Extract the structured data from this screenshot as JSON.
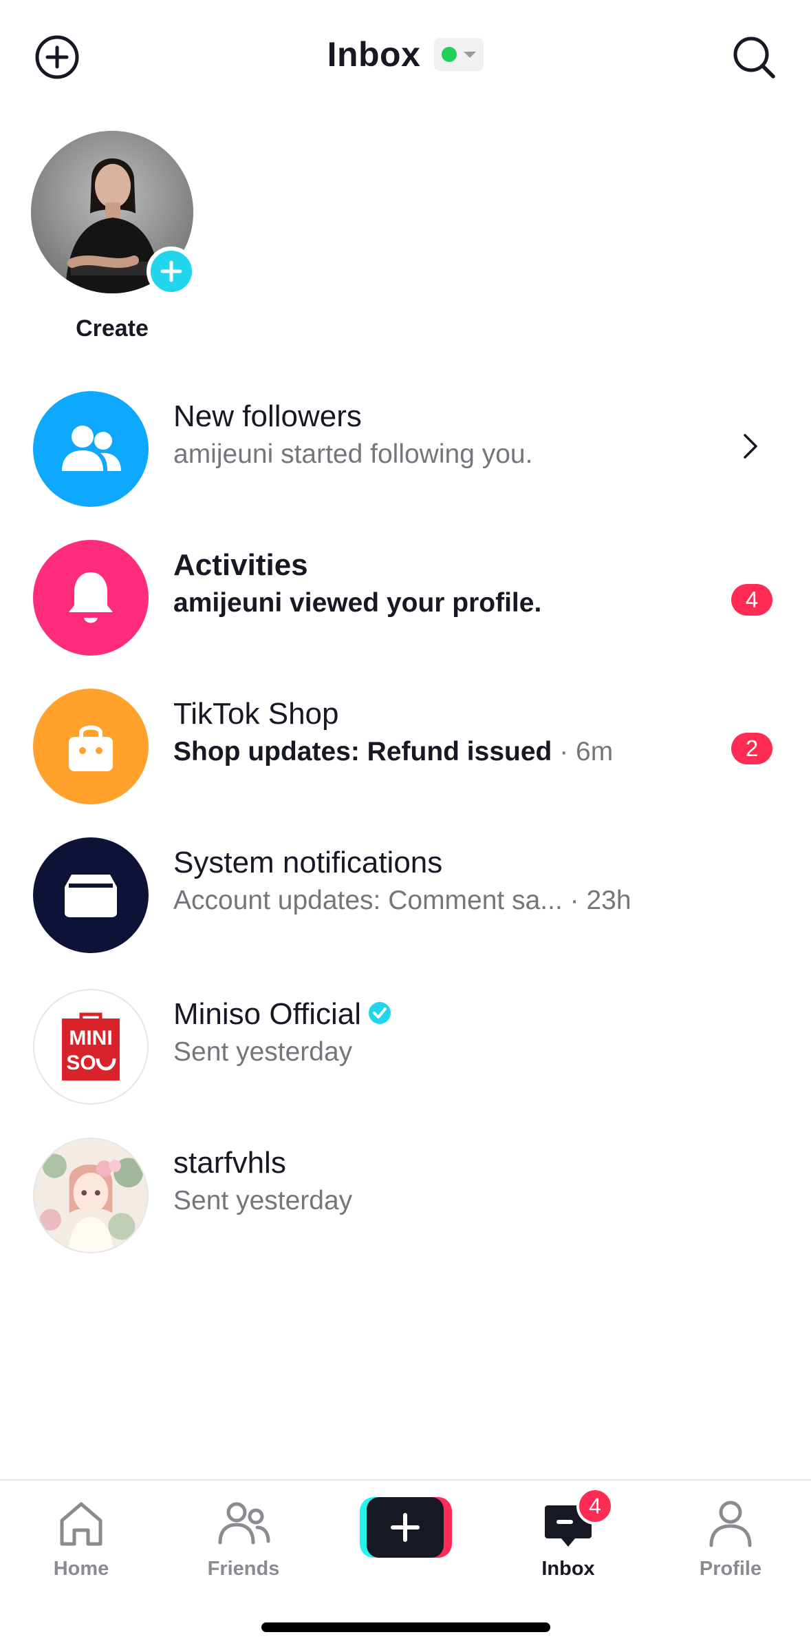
{
  "header": {
    "title": "Inbox",
    "add_icon": "plus-circle-icon",
    "search_icon": "search-icon",
    "status_color": "#20d05a"
  },
  "create": {
    "label": "Create",
    "plus_icon": "plus-icon"
  },
  "rows": [
    {
      "title": "New followers",
      "subtitle": "amijeuni started following you.",
      "meta": "",
      "icon": "followers-icon",
      "icon_bg": "#0fa8ff",
      "bold": false,
      "badge": ""
    },
    {
      "title": "Activities",
      "subtitle": "amijeuni viewed your profile.",
      "meta": "",
      "icon": "bell-icon",
      "icon_bg": "#fe2c7a",
      "bold": true,
      "badge": "4"
    },
    {
      "title": "TikTok Shop",
      "subtitle": "Shop updates: Refund issued",
      "meta": " · 6m",
      "icon": "shopping-bag-icon",
      "icon_bg": "#ffa12b",
      "bold": true,
      "badge": "2"
    },
    {
      "title": "System notifications",
      "subtitle": "Account updates: Comment sa...",
      "meta": "  · 23h",
      "icon": "inbox-tray-icon",
      "icon_bg": "#0f1237",
      "bold": false,
      "badge": ""
    },
    {
      "title": "Miniso Official",
      "subtitle": "Sent yesterday",
      "meta": "",
      "icon": "miniso-logo",
      "logo_text_1": "MINI",
      "logo_text_2": "SO",
      "verified": true,
      "bold": false,
      "badge": ""
    },
    {
      "title": "starfvhls",
      "subtitle": "Sent yesterday",
      "meta": "",
      "icon": "user-avatar",
      "bold": false,
      "badge": ""
    }
  ],
  "nav": {
    "home": "Home",
    "friends": "Friends",
    "inbox": "Inbox",
    "inbox_badge": "4",
    "profile": "Profile"
  },
  "colors": {
    "accent_red": "#fe2c55",
    "accent_cyan": "#25f4ee",
    "text_primary": "#161823",
    "text_secondary": "#75767c"
  }
}
